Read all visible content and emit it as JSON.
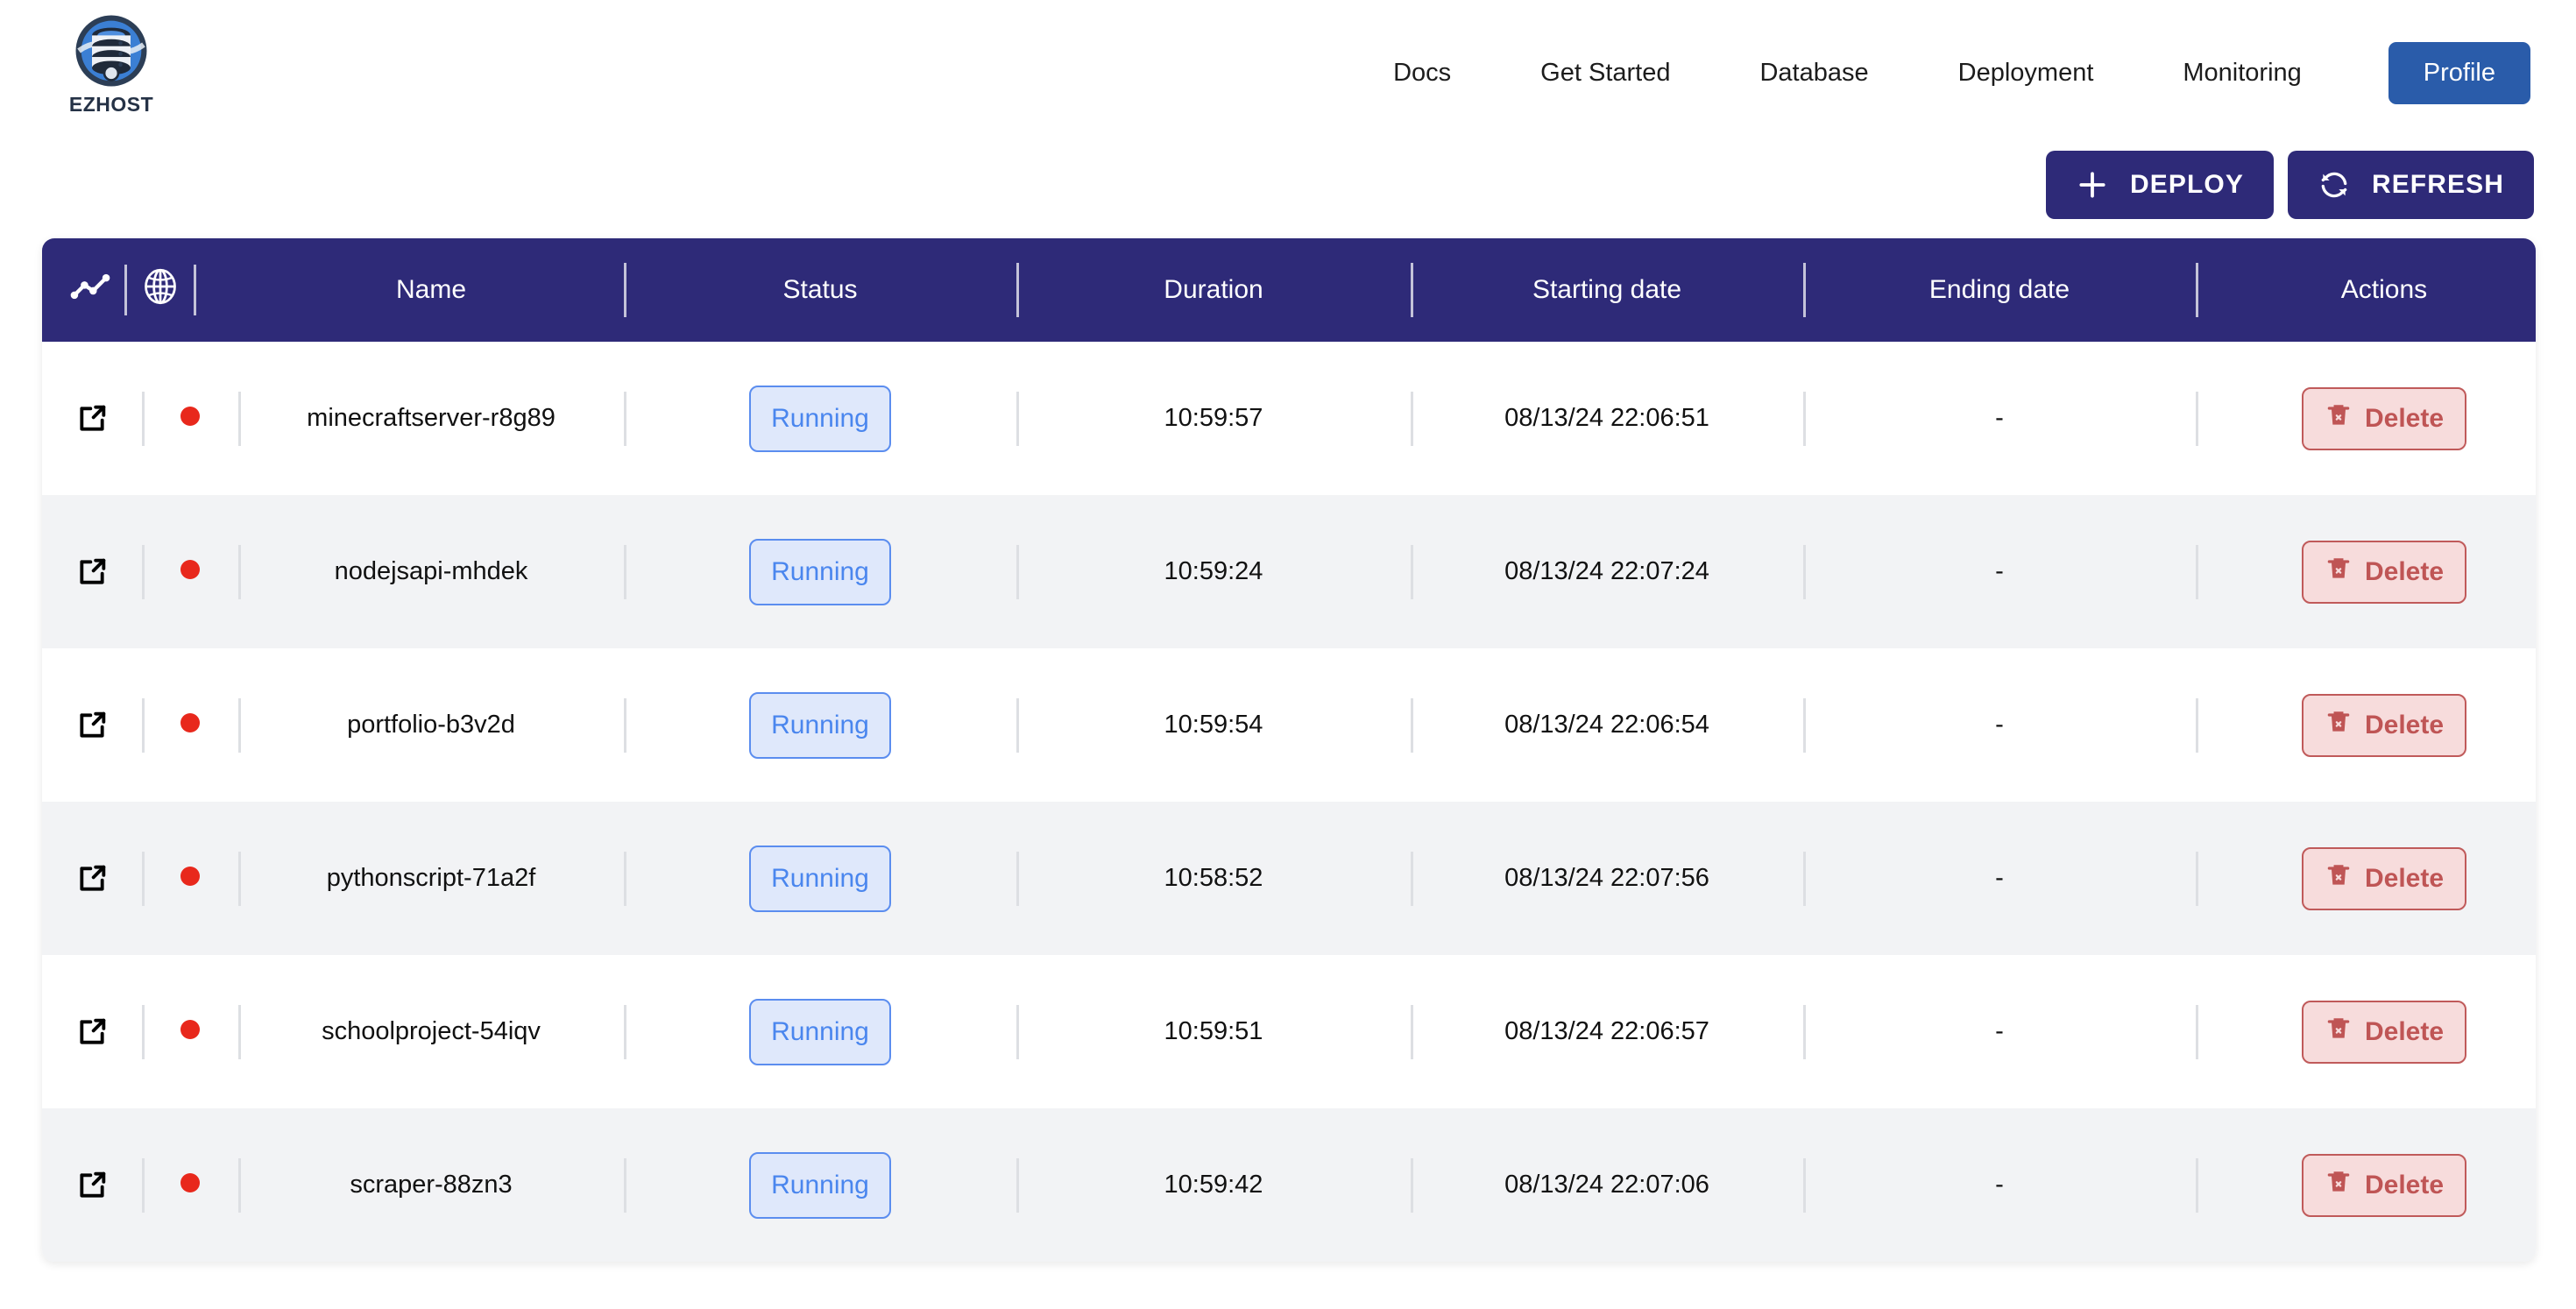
{
  "brand": {
    "name": "EZHOST",
    "logo_icon": "database-globe-logo"
  },
  "nav": {
    "links": [
      {
        "label": "Docs",
        "name": "nav-docs"
      },
      {
        "label": "Get Started",
        "name": "nav-get-started"
      },
      {
        "label": "Database",
        "name": "nav-database"
      },
      {
        "label": "Deployment",
        "name": "nav-deployment"
      },
      {
        "label": "Monitoring",
        "name": "nav-monitoring"
      }
    ],
    "profile_label": "Profile",
    "profile_color": "#2a5caa"
  },
  "toolbar": {
    "deploy_label": "DEPLOY",
    "deploy_icon": "plus-icon",
    "refresh_label": "REFRESH",
    "refresh_icon": "refresh-icon",
    "button_color": "#2e2a78"
  },
  "table": {
    "header_color": "#2e2a78",
    "header_icons": [
      {
        "name": "line-chart-icon"
      },
      {
        "name": "globe-icon"
      }
    ],
    "columns": [
      {
        "key": "name",
        "label": "Name"
      },
      {
        "key": "status",
        "label": "Status"
      },
      {
        "key": "duration",
        "label": "Duration"
      },
      {
        "key": "starting_date",
        "label": "Starting date"
      },
      {
        "key": "ending_date",
        "label": "Ending date"
      },
      {
        "key": "actions",
        "label": "Actions"
      }
    ],
    "row_icons": {
      "open_external": "external-link-icon",
      "status_dot": "status-dot-icon",
      "delete": "trash-icon"
    },
    "status_colors": {
      "running_text": "#4a86ee",
      "running_bg": "#dfe8fb",
      "running_border": "#5b8def",
      "dot": "#e8281c"
    },
    "delete_label": "Delete",
    "rows": [
      {
        "name": "minecraftserver-r8g89",
        "status": "Running",
        "duration": "10:59:57",
        "starting_date": "08/13/24 22:06:51",
        "ending_date": "-"
      },
      {
        "name": "nodejsapi-mhdek",
        "status": "Running",
        "duration": "10:59:24",
        "starting_date": "08/13/24 22:07:24",
        "ending_date": "-"
      },
      {
        "name": "portfolio-b3v2d",
        "status": "Running",
        "duration": "10:59:54",
        "starting_date": "08/13/24 22:06:54",
        "ending_date": "-"
      },
      {
        "name": "pythonscript-71a2f",
        "status": "Running",
        "duration": "10:58:52",
        "starting_date": "08/13/24 22:07:56",
        "ending_date": "-"
      },
      {
        "name": "schoolproject-54iqv",
        "status": "Running",
        "duration": "10:59:51",
        "starting_date": "08/13/24 22:06:57",
        "ending_date": "-"
      },
      {
        "name": "scraper-88zn3",
        "status": "Running",
        "duration": "10:59:42",
        "starting_date": "08/13/24 22:07:06",
        "ending_date": "-"
      }
    ]
  }
}
